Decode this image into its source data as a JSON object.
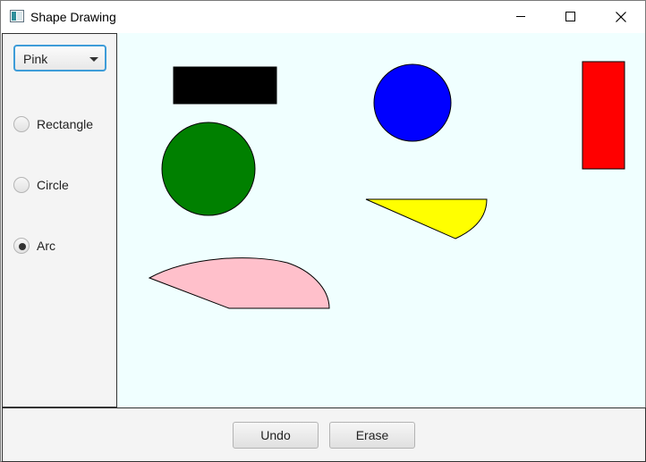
{
  "window": {
    "title": "Shape Drawing"
  },
  "toolbar": {
    "color_select_value": "Pink",
    "shape_options": [
      {
        "label": "Rectangle",
        "selected": false
      },
      {
        "label": "Circle",
        "selected": false
      },
      {
        "label": "Arc",
        "selected": true
      }
    ]
  },
  "canvas": {
    "background": "#f0ffff",
    "shapes": [
      {
        "kind": "rectangle",
        "fill": "#000000"
      },
      {
        "kind": "circle",
        "fill": "#0000ff"
      },
      {
        "kind": "rectangle",
        "fill": "#ff0000"
      },
      {
        "kind": "circle",
        "fill": "#008000"
      },
      {
        "kind": "arc",
        "fill": "#ffff00"
      },
      {
        "kind": "arc",
        "fill": "#ffc0cb"
      }
    ]
  },
  "actions": {
    "undo_label": "Undo",
    "erase_label": "Erase"
  },
  "icons": [
    "app-icon",
    "minimize-icon",
    "maximize-icon",
    "close-icon",
    "chevron-down-icon"
  ]
}
